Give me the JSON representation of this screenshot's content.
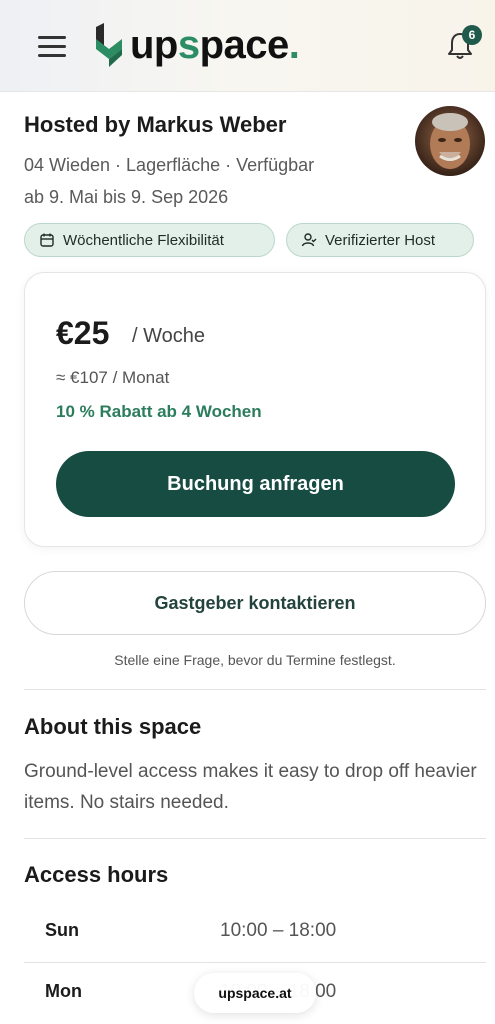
{
  "header": {
    "logo_text_pre": "up",
    "logo_text_accent": "s",
    "logo_text_post": "pace",
    "logo_dot": ".",
    "notification_count": "6",
    "colors": {
      "brand_green": "#2c8c63",
      "dark_green": "#174c42"
    }
  },
  "host": {
    "title": "Hosted by Markus Weber",
    "meta_line_1": "04 Wieden · Lagerfläche · Verfügbar",
    "meta_line_2": "ab 9. Mai bis 9. Sep 2026",
    "chips": [
      {
        "label": "Wöchentliche Flexibilität",
        "icon": "calendar-icon"
      },
      {
        "label": "Verifizierter Host",
        "icon": "user-check-icon"
      }
    ]
  },
  "pricing": {
    "price": "€25",
    "unit": "/ Woche",
    "monthly": "≈ €107 / Monat",
    "discount": "10 % Rabatt ab 4 Wochen",
    "book_label": "Buchung anfragen"
  },
  "contact": {
    "button_label": "Gastgeber kontaktieren",
    "hint": "Stelle eine Frage, bevor du Termine festlegst."
  },
  "about": {
    "title": "About this space",
    "text": "Ground-level access makes it easy to drop off heavier items. No stairs needed."
  },
  "access_hours": {
    "title": "Access hours",
    "rows": [
      {
        "day": "Sun",
        "time": "10:00 – 18:00"
      },
      {
        "day": "Mon",
        "time": "10:00 – 18:00"
      }
    ]
  },
  "browser": {
    "url": "upspace.at"
  }
}
